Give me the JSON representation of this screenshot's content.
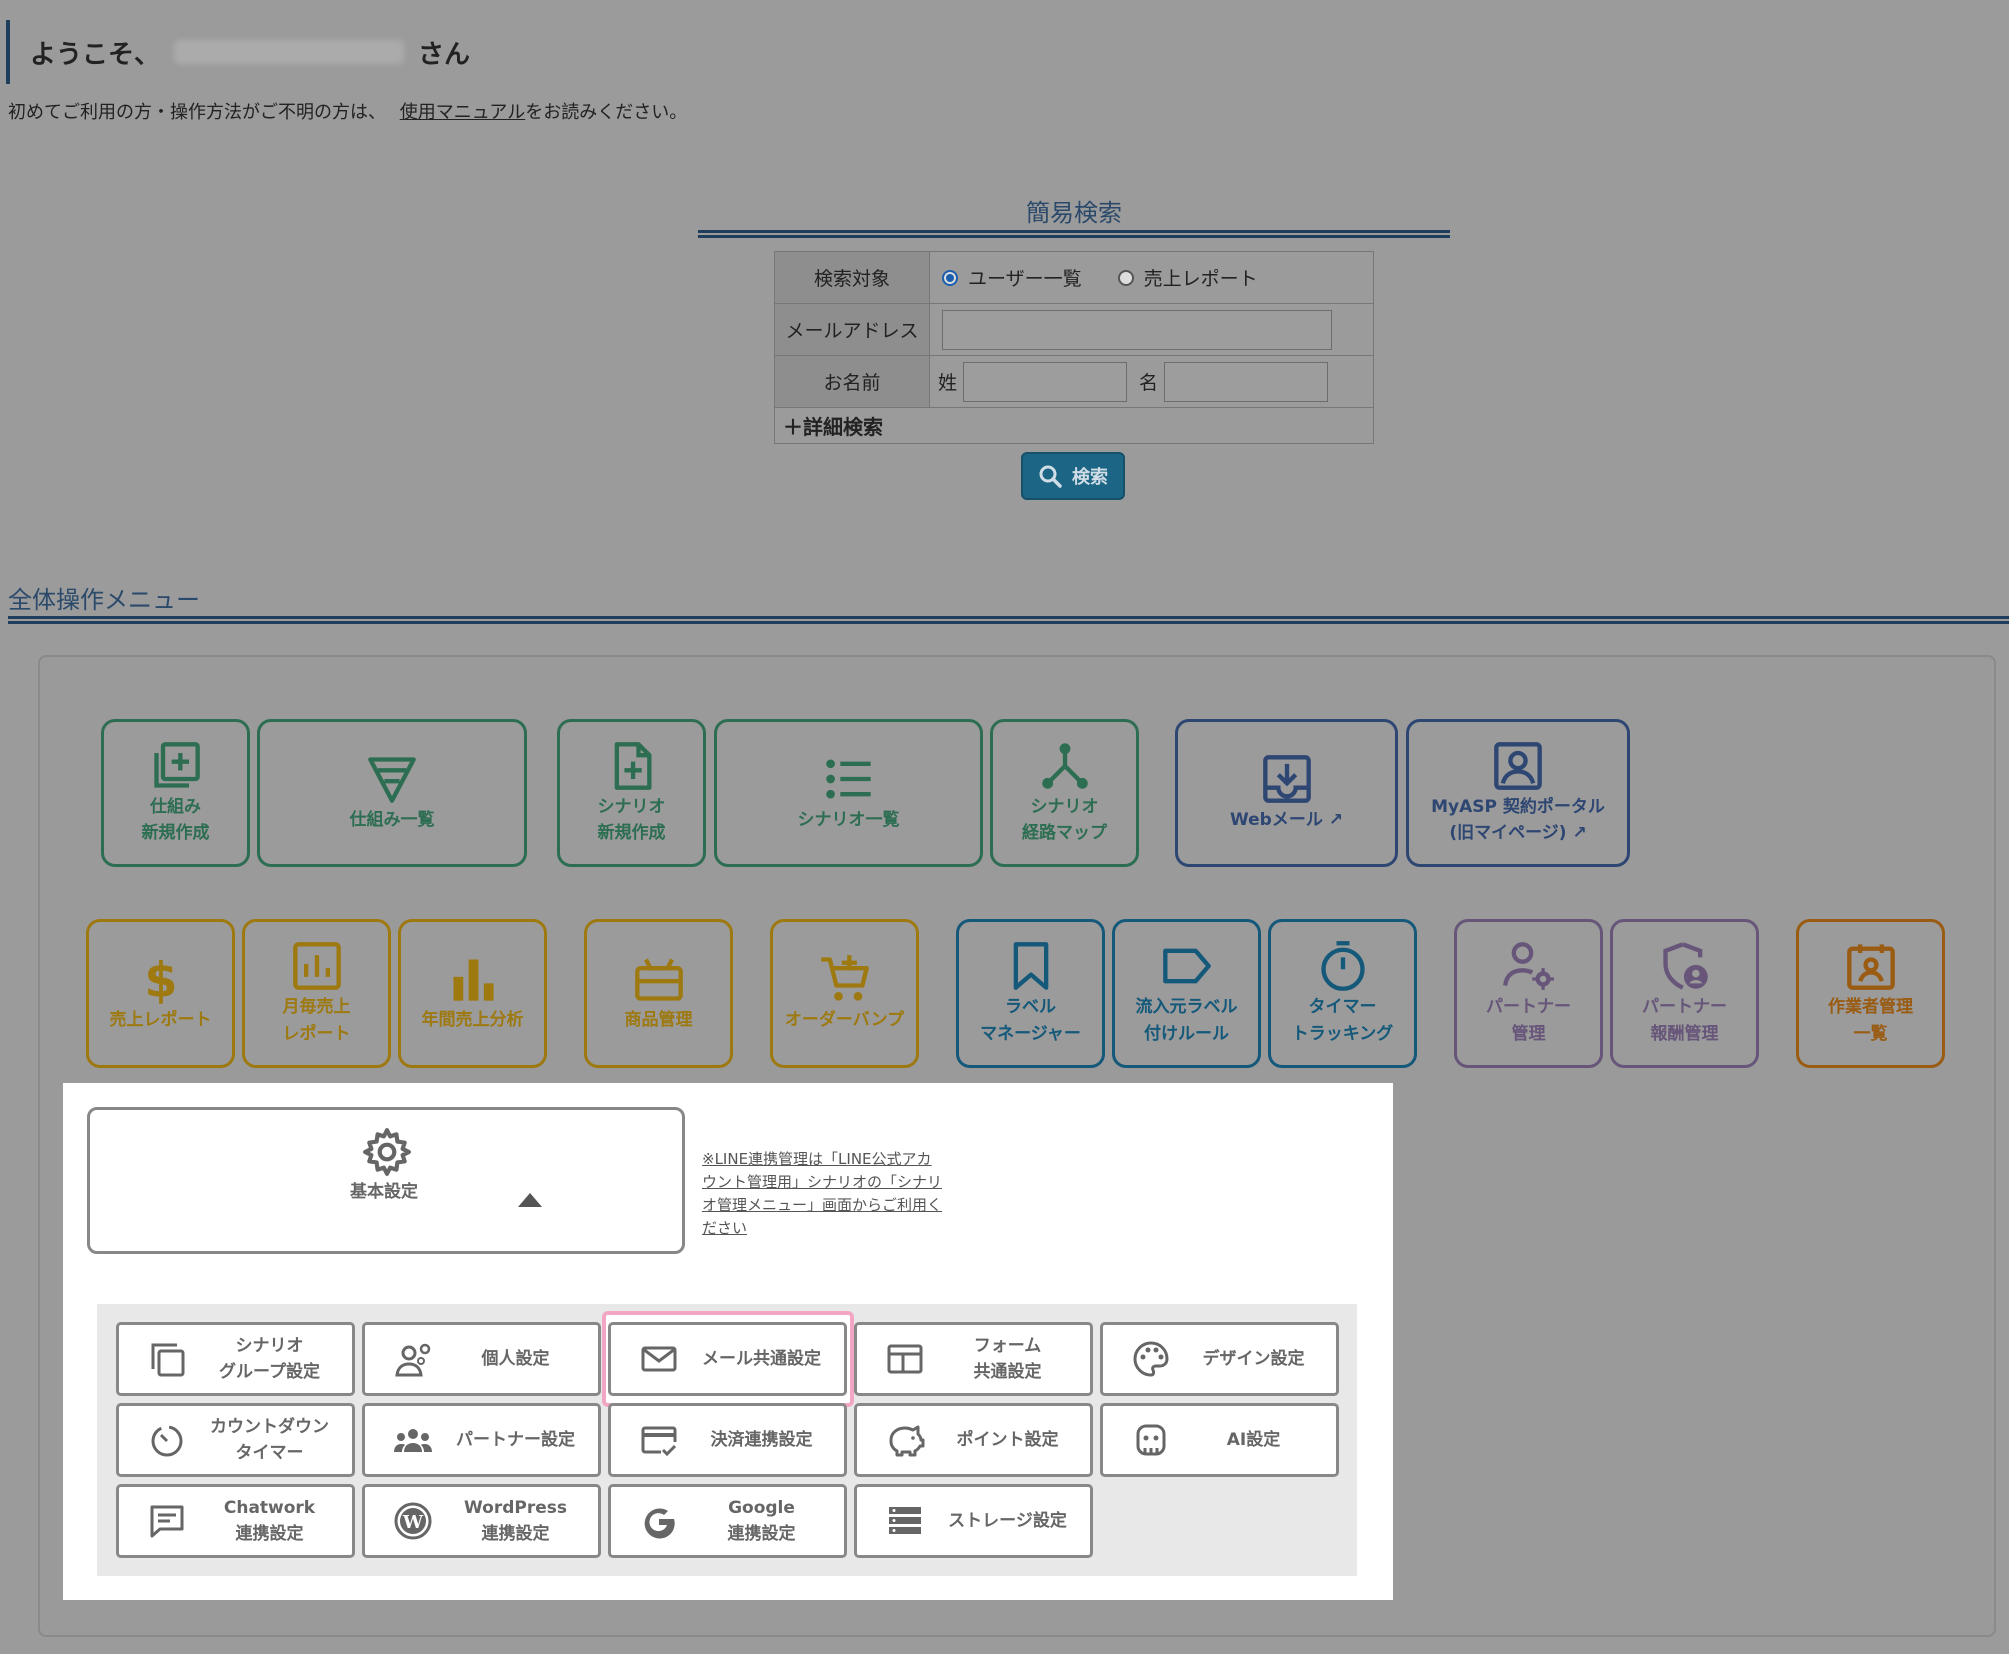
{
  "header": {
    "welcome_prefix": "ようこそ、",
    "welcome_suffix": "さん",
    "intro_before": "初めてご利用の方・操作方法がご不明の方は、",
    "intro_link": "使用マニュアル",
    "intro_after": "をお読みください。"
  },
  "search": {
    "title": "簡易検索",
    "target_label": "検索対象",
    "option_users": "ユーザー一覧",
    "option_sales": "売上レポート",
    "email_label": "メールアドレス",
    "name_label": "お名前",
    "last_name_label": "姓",
    "first_name_label": "名",
    "detail_link": "＋詳細検索",
    "button": "検索"
  },
  "menu": {
    "title": "全体操作メニュー",
    "row1": [
      {
        "l1": "仕組み",
        "l2": "新規作成"
      },
      {
        "l1": "仕組み一覧",
        "l2": ""
      },
      {
        "l1": "シナリオ",
        "l2": "新規作成"
      },
      {
        "l1": "シナリオ一覧",
        "l2": ""
      },
      {
        "l1": "シナリオ",
        "l2": "経路マップ"
      },
      {
        "l1": "Webメール",
        "l2": ""
      },
      {
        "l1": "MyASP 契約ポータル",
        "l2": "(旧マイページ)"
      }
    ],
    "row2": [
      {
        "l1": "売上レポート",
        "l2": ""
      },
      {
        "l1": "月毎売上",
        "l2": "レポート"
      },
      {
        "l1": "年間売上分析",
        "l2": ""
      },
      {
        "l1": "商品管理",
        "l2": ""
      },
      {
        "l1": "オーダーバンプ",
        "l2": ""
      },
      {
        "l1": "ラベル",
        "l2": "マネージャー"
      },
      {
        "l1": "流入元ラベル",
        "l2": "付けルール"
      },
      {
        "l1": "タイマー",
        "l2": "トラッキング"
      },
      {
        "l1": "パートナー",
        "l2": "管理"
      },
      {
        "l1": "パートナー",
        "l2": "報酬管理"
      },
      {
        "l1": "作業者管理",
        "l2": "一覧"
      }
    ],
    "basic_settings": "基本設定",
    "line_note": "※LINE連携管理は「LINE公式アカウント管理用」シナリオの「シナリオ管理メニュー」画面からご利用ください",
    "settings": [
      {
        "l1": "シナリオ",
        "l2": "グループ設定"
      },
      {
        "l1": "個人設定",
        "l2": ""
      },
      {
        "l1": "メール共通設定",
        "l2": ""
      },
      {
        "l1": "フォーム",
        "l2": "共通設定"
      },
      {
        "l1": "デザイン設定",
        "l2": ""
      },
      {
        "l1": "カウントダウン",
        "l2": "タイマー"
      },
      {
        "l1": "パートナー設定",
        "l2": ""
      },
      {
        "l1": "決済連携設定",
        "l2": ""
      },
      {
        "l1": "ポイント設定",
        "l2": ""
      },
      {
        "l1": "AI設定",
        "l2": ""
      },
      {
        "l1": "Chatwork",
        "l2": "連携設定"
      },
      {
        "l1": "WordPress",
        "l2": "連携設定"
      },
      {
        "l1": "Google",
        "l2": "連携設定"
      },
      {
        "l1": "ストレージ設定",
        "l2": ""
      }
    ]
  },
  "colors": {
    "green": "#2d6e52",
    "navy": "#2d4672",
    "gold": "#9d7910",
    "teal": "#14587a",
    "purple": "#67557a",
    "orange": "#9a5b12",
    "highlight": "#f2a6c4"
  }
}
